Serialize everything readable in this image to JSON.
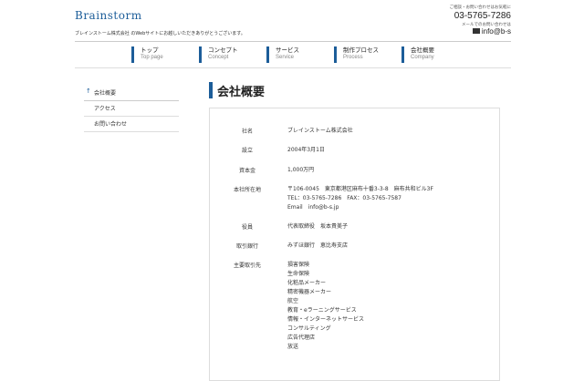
{
  "header": {
    "logo_text": "Brainstorm",
    "tagline": "ブレインストーム株式会社 のWebサイトにお越しいただきありがとうございます。",
    "contact_note": "ご相談・お問い合わせはお気軽に",
    "phone": "03-5765-7286",
    "email_note": "メールでのお問い合わせは",
    "email": "info@b-s"
  },
  "nav": [
    {
      "jp": "トップ",
      "en": "Top page"
    },
    {
      "jp": "コンセプト",
      "en": "Concept"
    },
    {
      "jp": "サービス",
      "en": "Service"
    },
    {
      "jp": "制作プロセス",
      "en": "Process"
    },
    {
      "jp": "会社概要",
      "en": "Company"
    }
  ],
  "sidebar": {
    "items": [
      {
        "label": "会社概要",
        "active": true
      },
      {
        "label": "アクセス",
        "active": false
      },
      {
        "label": "お問い合わせ",
        "active": false
      }
    ]
  },
  "page_title": "会社概要",
  "company": {
    "rows": [
      {
        "label": "社名",
        "lines": [
          "ブレインストーム株式会社"
        ]
      },
      {
        "label": "設立",
        "lines": [
          "2004年3月1日"
        ]
      },
      {
        "label": "資本金",
        "lines": [
          "1,000万円"
        ]
      },
      {
        "label": "本社所在地",
        "lines": [
          "〒106-0045　東京都港区麻布十番3-3-8　麻布共和ビル3F",
          "TEL：03-5765-7286　FAX：03-5765-7587",
          "Email　info@b-s.jp"
        ]
      },
      {
        "label": "役員",
        "lines": [
          "代表取締役　坂本貴美子"
        ]
      },
      {
        "label": "取引銀行",
        "lines": [
          "みずほ銀行　恵比寿支店"
        ]
      },
      {
        "label": "主要取引先",
        "lines": [
          "損害保険",
          "生命保険",
          "化粧品メーカー",
          "精密機器メーカー",
          "航空",
          "教育・eラーニングサービス",
          "情報・インターネットサービス",
          "コンサルティング",
          "広告代理店",
          "放送"
        ]
      }
    ]
  }
}
